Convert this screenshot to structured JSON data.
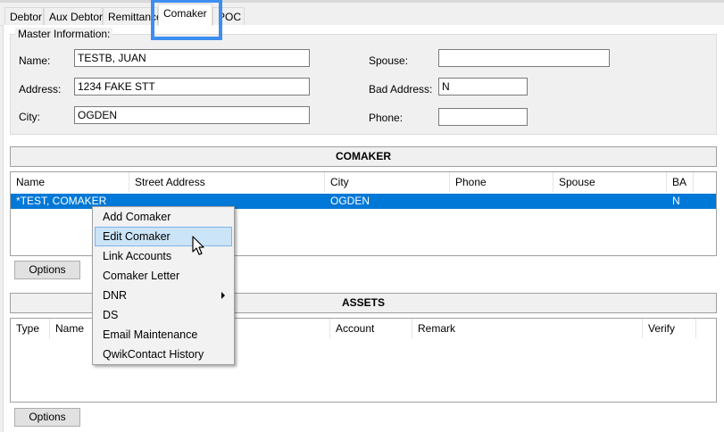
{
  "tabs": [
    {
      "label": "Debtor"
    },
    {
      "label": "Aux Debtor"
    },
    {
      "label": "Remittance"
    },
    {
      "label": "Comaker"
    },
    {
      "label": "POC"
    }
  ],
  "master": {
    "title": "Master Information:",
    "name_label": "Name:",
    "name_value": "TESTB, JUAN",
    "address_label": "Address:",
    "address_value": "1234 FAKE STT",
    "city_label": "City:",
    "city_value": "OGDEN",
    "spouse_label": "Spouse:",
    "spouse_value": "",
    "bad_address_label": "Bad Address:",
    "bad_address_value": "N",
    "phone_label": "Phone:",
    "phone_value": ""
  },
  "comaker": {
    "title": "COMAKER",
    "columns": [
      "Name",
      "Street Address",
      "City",
      "Phone",
      "Spouse",
      "BA"
    ],
    "rows": [
      {
        "name": "*TEST, COMAKER",
        "street": "",
        "city": "OGDEN",
        "phone": "",
        "spouse": "",
        "ba": "N"
      }
    ],
    "options_label": "Options"
  },
  "assets": {
    "title": "ASSETS",
    "columns": [
      "Type",
      "Name",
      "Account",
      "Remark",
      "Verify"
    ],
    "options_label": "Options"
  },
  "context_menu": {
    "items": [
      {
        "label": "Add Comaker"
      },
      {
        "label": "Edit Comaker"
      },
      {
        "label": "Link Accounts"
      },
      {
        "label": "Comaker Letter"
      },
      {
        "label": "DNR"
      },
      {
        "label": "DS"
      },
      {
        "label": "Email Maintenance"
      },
      {
        "label": "QwikContact History"
      }
    ]
  },
  "colors": {
    "selection": "#0078d7",
    "menu_hover": "#cce4f7",
    "tab_highlight": "#3d8ef0"
  }
}
